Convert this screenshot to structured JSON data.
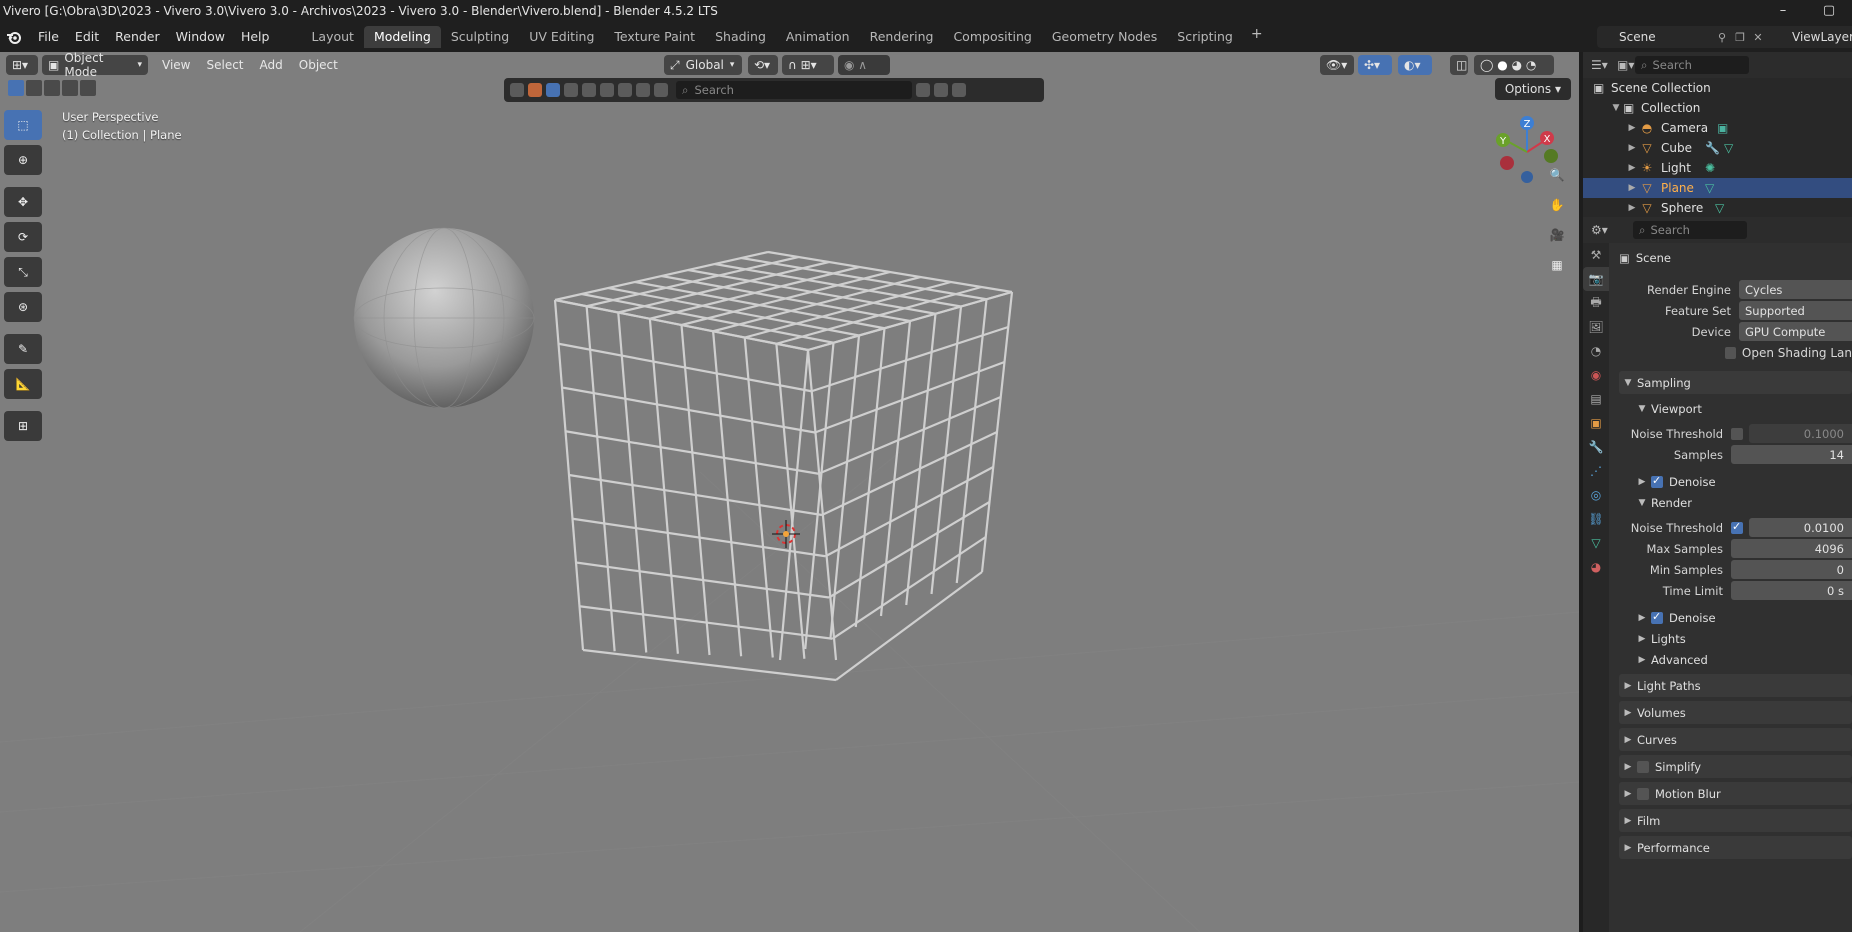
{
  "window": {
    "title": "Vivero [G:\\Obra\\3D\\2023 - Vivero 3.0\\Vivero 3.0 - Archivos\\2023 - Vivero 3.0 - Blender\\Vivero.blend] - Blender 4.5.2 LTS",
    "minimize": "–",
    "maximize": "▢"
  },
  "menus": [
    "File",
    "Edit",
    "Render",
    "Window",
    "Help"
  ],
  "workspaces": [
    {
      "label": "Layout"
    },
    {
      "label": "Modeling",
      "active": true
    },
    {
      "label": "Sculpting"
    },
    {
      "label": "UV Editing"
    },
    {
      "label": "Texture Paint"
    },
    {
      "label": "Shading"
    },
    {
      "label": "Animation"
    },
    {
      "label": "Rendering"
    },
    {
      "label": "Compositing"
    },
    {
      "label": "Geometry Nodes"
    },
    {
      "label": "Scripting"
    }
  ],
  "workspace_add": "+",
  "scene": {
    "name": "Scene"
  },
  "view_layer": {
    "name": "ViewLayer"
  },
  "viewport": {
    "mode": "Object Mode",
    "menus": [
      "View",
      "Select",
      "Add",
      "Object"
    ],
    "transform_orientation": "Global",
    "search_placeholder": "Search",
    "options_label": "Options",
    "info_line1": "User Perspective",
    "info_line2": "(1) Collection | Plane",
    "gizmo_axes": {
      "x": "X",
      "y": "Y",
      "z": "Z"
    }
  },
  "outliner": {
    "search_placeholder": "Search",
    "root": "Scene Collection",
    "collection": "Collection",
    "items": [
      {
        "name": "Camera",
        "icon": "camera-icon",
        "color": "#e39b45"
      },
      {
        "name": "Cube",
        "icon": "mesh-icon",
        "color": "#e39b45"
      },
      {
        "name": "Light",
        "icon": "light-icon",
        "color": "#e39b45"
      },
      {
        "name": "Plane",
        "icon": "mesh-icon",
        "color": "#e39b45",
        "selected": true
      },
      {
        "name": "Sphere",
        "icon": "mesh-icon",
        "color": "#e39b45"
      }
    ]
  },
  "properties": {
    "search_placeholder": "Search",
    "context": "Scene",
    "render_engine": {
      "label": "Render Engine",
      "value": "Cycles"
    },
    "feature_set": {
      "label": "Feature Set",
      "value": "Supported"
    },
    "device": {
      "label": "Device",
      "value": "GPU Compute"
    },
    "open_shading_language": "Open Shading Lan",
    "sampling": {
      "title": "Sampling",
      "viewport": {
        "title": "Viewport",
        "noise_threshold": {
          "label": "Noise Threshold",
          "value": "0.1000",
          "enabled": false
        },
        "samples": {
          "label": "Samples",
          "value": "14"
        },
        "denoise": {
          "label": "Denoise",
          "checked": true
        }
      },
      "render": {
        "title": "Render",
        "noise_threshold": {
          "label": "Noise Threshold",
          "value": "0.0100",
          "enabled": true
        },
        "max_samples": {
          "label": "Max Samples",
          "value": "4096"
        },
        "min_samples": {
          "label": "Min Samples",
          "value": "0"
        },
        "time_limit": {
          "label": "Time Limit",
          "value": "0 s"
        },
        "denoise": {
          "label": "Denoise",
          "checked": true
        }
      },
      "lights": "Lights",
      "advanced": "Advanced"
    },
    "panels": {
      "light_paths": "Light Paths",
      "volumes": "Volumes",
      "curves": "Curves",
      "simplify": "Simplify",
      "motion_blur": "Motion Blur",
      "film": "Film",
      "performance": "Performance"
    }
  },
  "colors": {
    "accent": "#4772b3",
    "selected_text": "#ffb04a",
    "viewport_bg": "#7e7e7e",
    "axis_x": "#d03a4a",
    "axis_y": "#6aa12a",
    "axis_z": "#3d7fd4"
  }
}
